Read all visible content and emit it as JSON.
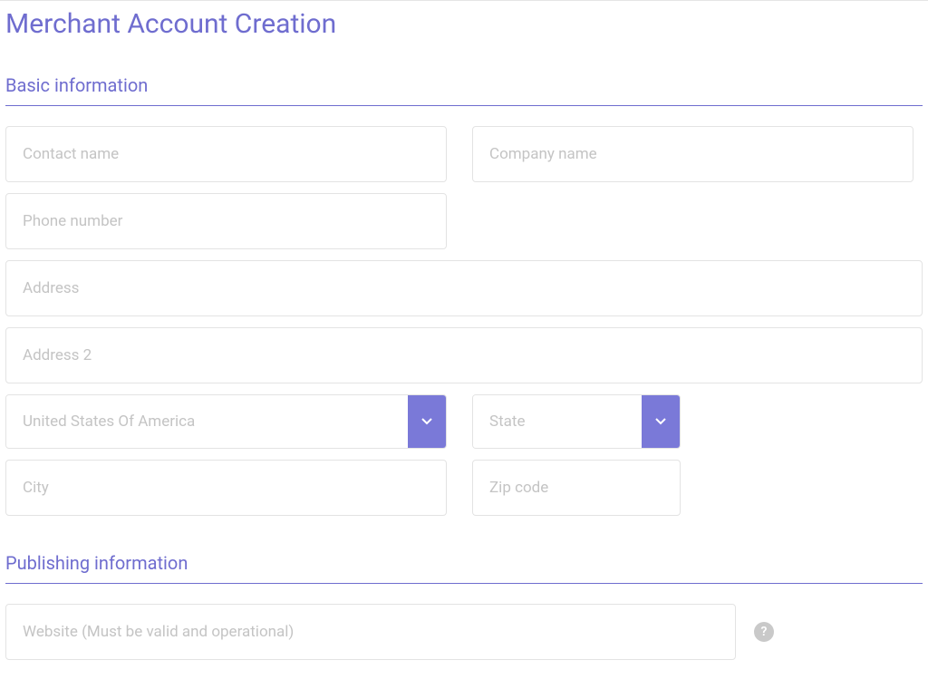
{
  "page": {
    "title": "Merchant Account Creation"
  },
  "sections": {
    "basic": {
      "title": "Basic information"
    },
    "publishing": {
      "title": "Publishing information"
    }
  },
  "fields": {
    "contact_name": {
      "placeholder": "Contact name",
      "value": ""
    },
    "company_name": {
      "placeholder": "Company name",
      "value": ""
    },
    "phone_number": {
      "placeholder": "Phone number",
      "value": ""
    },
    "address": {
      "placeholder": "Address",
      "value": ""
    },
    "address2": {
      "placeholder": "Address 2",
      "value": ""
    },
    "country": {
      "selected": "United States Of America"
    },
    "state": {
      "selected": "State"
    },
    "city": {
      "placeholder": "City",
      "value": ""
    },
    "zip": {
      "placeholder": "Zip code",
      "value": ""
    },
    "website": {
      "placeholder": "Website (Must be valid and operational)",
      "value": ""
    }
  },
  "icons": {
    "help": "?"
  },
  "colors": {
    "accent": "#6f6dcf",
    "select_caret_bg": "#7a79d8",
    "placeholder": "#c4c4c4",
    "border": "#e3e3e3"
  }
}
